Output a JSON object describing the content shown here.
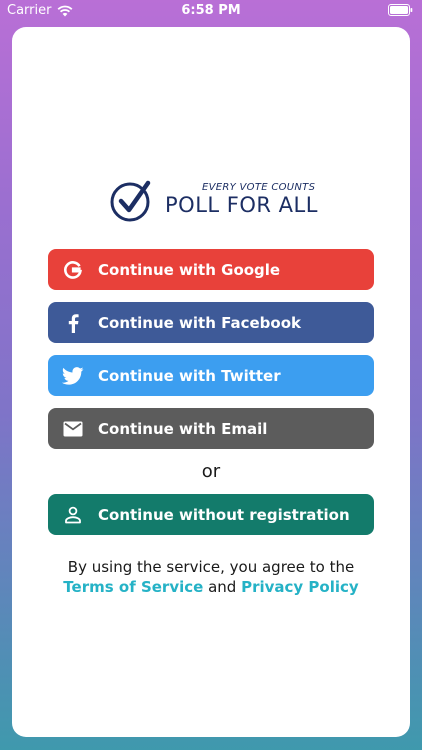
{
  "status_bar": {
    "carrier": "Carrier",
    "time": "6:58 PM"
  },
  "logo": {
    "tagline": "EVERY VOTE COUNTS",
    "name": "POLL FOR ALL"
  },
  "auth_buttons": {
    "google": "Continue with Google",
    "facebook": "Continue with Facebook",
    "twitter": "Continue with Twitter",
    "email": "Continue with Email"
  },
  "separator": "or",
  "guest_button": "Continue without registration",
  "terms": {
    "prefix": "By using the service, you agree to the",
    "terms_link": "Terms of Service",
    "conjunction": "and",
    "privacy_link": "Privacy Policy"
  },
  "colors": {
    "google": "#e8413a",
    "facebook": "#3e5a98",
    "twitter": "#3c9ef0",
    "email": "#5c5c5c",
    "guest": "#137b6b",
    "link": "#25b2c6",
    "brand": "#1c2e63"
  },
  "icons": {
    "google": "google-g-icon",
    "facebook": "facebook-f-icon",
    "twitter": "twitter-bird-icon",
    "email": "envelope-icon",
    "guest": "person-icon"
  }
}
